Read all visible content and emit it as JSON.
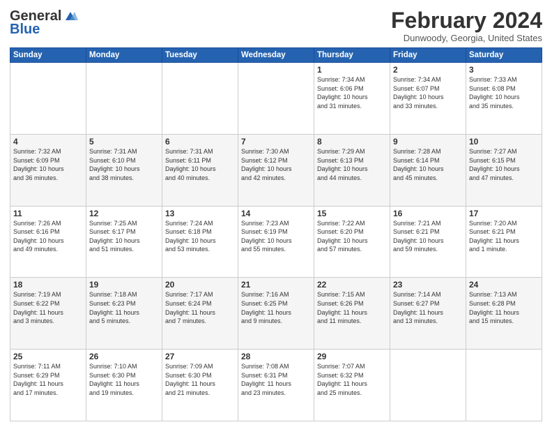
{
  "logo": {
    "line1": "General",
    "line2": "Blue"
  },
  "header": {
    "month_year": "February 2024",
    "location": "Dunwoody, Georgia, United States"
  },
  "days_of_week": [
    "Sunday",
    "Monday",
    "Tuesday",
    "Wednesday",
    "Thursday",
    "Friday",
    "Saturday"
  ],
  "weeks": [
    [
      {
        "day": "",
        "info": ""
      },
      {
        "day": "",
        "info": ""
      },
      {
        "day": "",
        "info": ""
      },
      {
        "day": "",
        "info": ""
      },
      {
        "day": "1",
        "info": "Sunrise: 7:34 AM\nSunset: 6:06 PM\nDaylight: 10 hours\nand 31 minutes."
      },
      {
        "day": "2",
        "info": "Sunrise: 7:34 AM\nSunset: 6:07 PM\nDaylight: 10 hours\nand 33 minutes."
      },
      {
        "day": "3",
        "info": "Sunrise: 7:33 AM\nSunset: 6:08 PM\nDaylight: 10 hours\nand 35 minutes."
      }
    ],
    [
      {
        "day": "4",
        "info": "Sunrise: 7:32 AM\nSunset: 6:09 PM\nDaylight: 10 hours\nand 36 minutes."
      },
      {
        "day": "5",
        "info": "Sunrise: 7:31 AM\nSunset: 6:10 PM\nDaylight: 10 hours\nand 38 minutes."
      },
      {
        "day": "6",
        "info": "Sunrise: 7:31 AM\nSunset: 6:11 PM\nDaylight: 10 hours\nand 40 minutes."
      },
      {
        "day": "7",
        "info": "Sunrise: 7:30 AM\nSunset: 6:12 PM\nDaylight: 10 hours\nand 42 minutes."
      },
      {
        "day": "8",
        "info": "Sunrise: 7:29 AM\nSunset: 6:13 PM\nDaylight: 10 hours\nand 44 minutes."
      },
      {
        "day": "9",
        "info": "Sunrise: 7:28 AM\nSunset: 6:14 PM\nDaylight: 10 hours\nand 45 minutes."
      },
      {
        "day": "10",
        "info": "Sunrise: 7:27 AM\nSunset: 6:15 PM\nDaylight: 10 hours\nand 47 minutes."
      }
    ],
    [
      {
        "day": "11",
        "info": "Sunrise: 7:26 AM\nSunset: 6:16 PM\nDaylight: 10 hours\nand 49 minutes."
      },
      {
        "day": "12",
        "info": "Sunrise: 7:25 AM\nSunset: 6:17 PM\nDaylight: 10 hours\nand 51 minutes."
      },
      {
        "day": "13",
        "info": "Sunrise: 7:24 AM\nSunset: 6:18 PM\nDaylight: 10 hours\nand 53 minutes."
      },
      {
        "day": "14",
        "info": "Sunrise: 7:23 AM\nSunset: 6:19 PM\nDaylight: 10 hours\nand 55 minutes."
      },
      {
        "day": "15",
        "info": "Sunrise: 7:22 AM\nSunset: 6:20 PM\nDaylight: 10 hours\nand 57 minutes."
      },
      {
        "day": "16",
        "info": "Sunrise: 7:21 AM\nSunset: 6:21 PM\nDaylight: 10 hours\nand 59 minutes."
      },
      {
        "day": "17",
        "info": "Sunrise: 7:20 AM\nSunset: 6:21 PM\nDaylight: 11 hours\nand 1 minute."
      }
    ],
    [
      {
        "day": "18",
        "info": "Sunrise: 7:19 AM\nSunset: 6:22 PM\nDaylight: 11 hours\nand 3 minutes."
      },
      {
        "day": "19",
        "info": "Sunrise: 7:18 AM\nSunset: 6:23 PM\nDaylight: 11 hours\nand 5 minutes."
      },
      {
        "day": "20",
        "info": "Sunrise: 7:17 AM\nSunset: 6:24 PM\nDaylight: 11 hours\nand 7 minutes."
      },
      {
        "day": "21",
        "info": "Sunrise: 7:16 AM\nSunset: 6:25 PM\nDaylight: 11 hours\nand 9 minutes."
      },
      {
        "day": "22",
        "info": "Sunrise: 7:15 AM\nSunset: 6:26 PM\nDaylight: 11 hours\nand 11 minutes."
      },
      {
        "day": "23",
        "info": "Sunrise: 7:14 AM\nSunset: 6:27 PM\nDaylight: 11 hours\nand 13 minutes."
      },
      {
        "day": "24",
        "info": "Sunrise: 7:13 AM\nSunset: 6:28 PM\nDaylight: 11 hours\nand 15 minutes."
      }
    ],
    [
      {
        "day": "25",
        "info": "Sunrise: 7:11 AM\nSunset: 6:29 PM\nDaylight: 11 hours\nand 17 minutes."
      },
      {
        "day": "26",
        "info": "Sunrise: 7:10 AM\nSunset: 6:30 PM\nDaylight: 11 hours\nand 19 minutes."
      },
      {
        "day": "27",
        "info": "Sunrise: 7:09 AM\nSunset: 6:30 PM\nDaylight: 11 hours\nand 21 minutes."
      },
      {
        "day": "28",
        "info": "Sunrise: 7:08 AM\nSunset: 6:31 PM\nDaylight: 11 hours\nand 23 minutes."
      },
      {
        "day": "29",
        "info": "Sunrise: 7:07 AM\nSunset: 6:32 PM\nDaylight: 11 hours\nand 25 minutes."
      },
      {
        "day": "",
        "info": ""
      },
      {
        "day": "",
        "info": ""
      }
    ]
  ]
}
